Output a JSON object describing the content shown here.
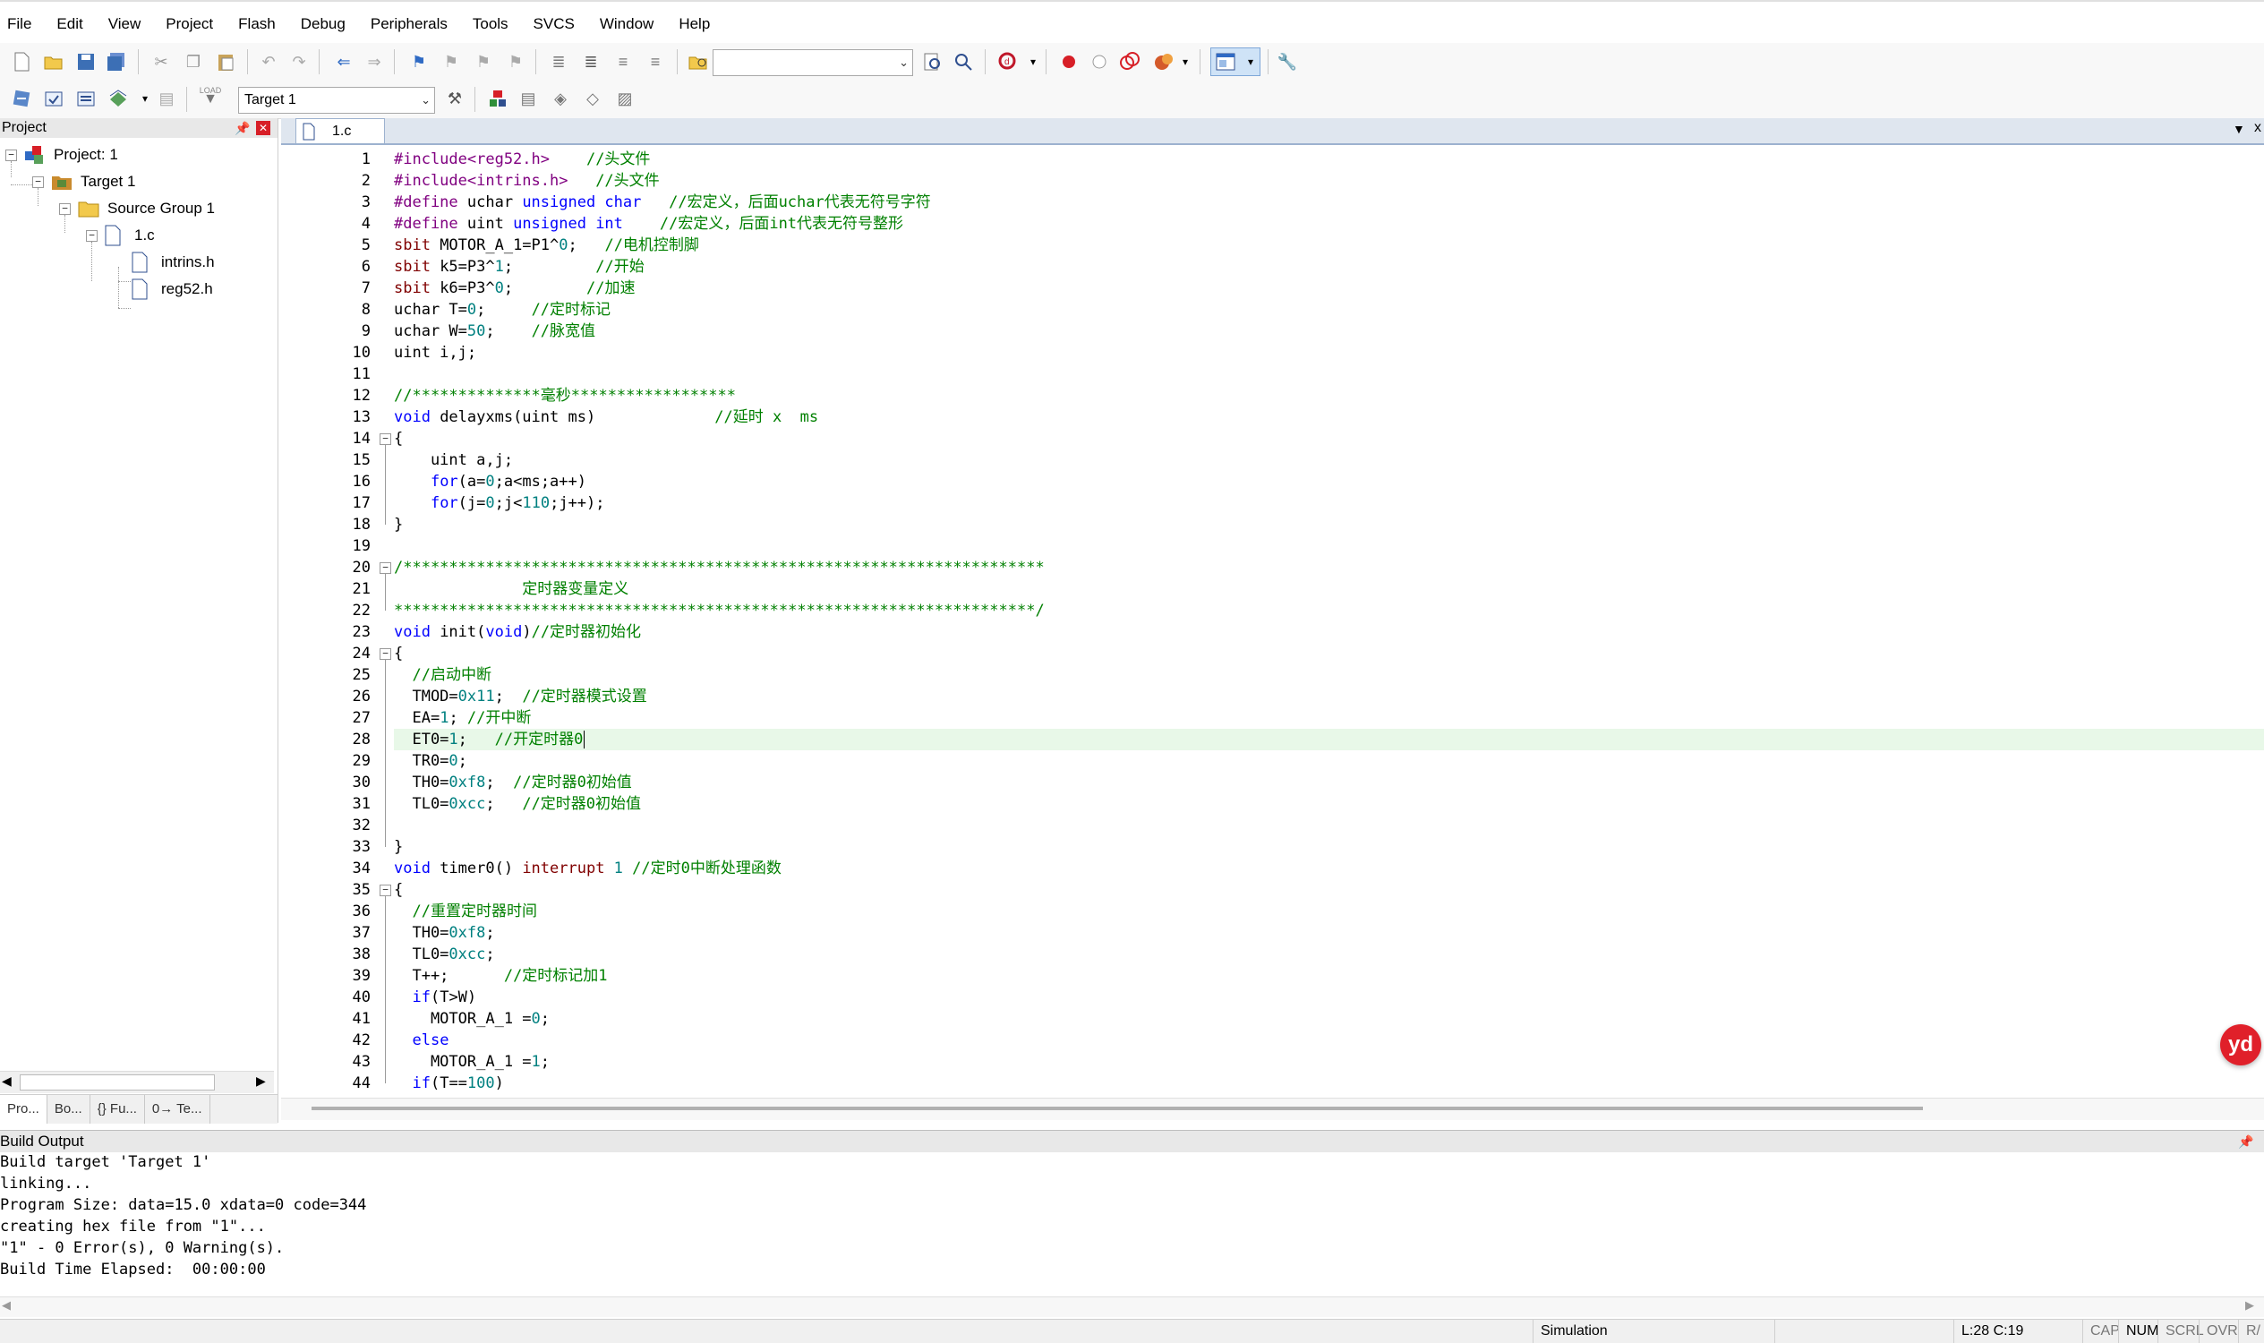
{
  "menu": [
    "File",
    "Edit",
    "View",
    "Project",
    "Flash",
    "Debug",
    "Peripherals",
    "Tools",
    "SVCS",
    "Window",
    "Help"
  ],
  "toolbar": {
    "target_select": "Target 1",
    "icons": [
      "new-file-icon",
      "open-file-icon",
      "save-icon",
      "save-all-icon",
      "cut-icon",
      "copy-icon",
      "paste-icon",
      "undo-icon",
      "redo-icon",
      "navigate-back-icon",
      "navigate-forward-icon",
      "bookmark-icon",
      "prev-bookmark-icon",
      "next-bookmark-icon",
      "clear-bookmarks-icon",
      "indent-icon",
      "unindent-icon",
      "comment-icon",
      "uncomment-icon",
      "find-in-files-icon",
      "find-icon",
      "incremental-find-icon",
      "debug-start-icon",
      "breakpoint-icon",
      "disable-breakpoint-icon",
      "kill-breakpoints-icon",
      "window-layout-icon",
      "configure-icon"
    ],
    "load_label": "LOAD"
  },
  "project": {
    "title": "Project",
    "tree": {
      "root": "Project: 1",
      "target": "Target 1",
      "group": "Source Group 1",
      "file": "1.c",
      "children": [
        "intrins.h",
        "reg52.h"
      ]
    },
    "tabs": [
      "Pro...",
      "Bo...",
      "{} Fu...",
      "0→ Te..."
    ]
  },
  "editor": {
    "tab": "1.c",
    "current_line": 28,
    "lines": [
      {
        "n": "1",
        "t": [
          [
            "pp",
            "#include<reg52.h>"
          ],
          [
            "",
            "    "
          ],
          [
            "cm",
            "//头文件"
          ]
        ]
      },
      {
        "n": "2",
        "t": [
          [
            "pp",
            "#include<intrins.h>"
          ],
          [
            "",
            "   "
          ],
          [
            "cm",
            "//头文件"
          ]
        ]
      },
      {
        "n": "3",
        "t": [
          [
            "pp",
            "#define"
          ],
          [
            "",
            " uchar "
          ],
          [
            "kw",
            "unsigned char"
          ],
          [
            "",
            "   "
          ],
          [
            "cm",
            "//宏定义，后面uchar代表无符号字符"
          ]
        ]
      },
      {
        "n": "4",
        "t": [
          [
            "pp",
            "#define"
          ],
          [
            "",
            " uint "
          ],
          [
            "kw",
            "unsigned int"
          ],
          [
            "",
            "    "
          ],
          [
            "cm",
            "//宏定义，后面int代表无符号整形"
          ]
        ]
      },
      {
        "n": "5",
        "t": [
          [
            "st",
            "sbit"
          ],
          [
            "",
            " MOTOR_A_1=P1^"
          ],
          [
            "nm",
            "0"
          ],
          [
            "",
            ";   "
          ],
          [
            "cm",
            "//电机控制脚"
          ]
        ]
      },
      {
        "n": "6",
        "t": [
          [
            "st",
            "sbit"
          ],
          [
            "",
            " k5=P3^"
          ],
          [
            "nm",
            "1"
          ],
          [
            "",
            ";         "
          ],
          [
            "cm",
            "//开始"
          ]
        ]
      },
      {
        "n": "7",
        "t": [
          [
            "st",
            "sbit"
          ],
          [
            "",
            " k6=P3^"
          ],
          [
            "nm",
            "0"
          ],
          [
            "",
            ";        "
          ],
          [
            "cm",
            "//加速"
          ]
        ]
      },
      {
        "n": "8",
        "t": [
          [
            "",
            "uchar T="
          ],
          [
            "nm",
            "0"
          ],
          [
            "",
            ";     "
          ],
          [
            "cm",
            "//定时标记"
          ]
        ]
      },
      {
        "n": "9",
        "t": [
          [
            "",
            "uchar W="
          ],
          [
            "nm",
            "50"
          ],
          [
            "",
            ";    "
          ],
          [
            "cm",
            "//脉宽值"
          ]
        ]
      },
      {
        "n": "10",
        "t": [
          [
            "",
            "uint i,j;"
          ]
        ]
      },
      {
        "n": "11",
        "t": []
      },
      {
        "n": "12",
        "t": [
          [
            "cm",
            "//**************毫秒******************"
          ]
        ]
      },
      {
        "n": "13",
        "t": [
          [
            "kw",
            "void"
          ],
          [
            "",
            " delayxms(uint ms)             "
          ],
          [
            "cm",
            "//延时 x  ms"
          ]
        ]
      },
      {
        "n": "14",
        "t": [
          [
            "",
            "{"
          ]
        ]
      },
      {
        "n": "15",
        "t": [
          [
            "",
            "    uint a,j;"
          ]
        ]
      },
      {
        "n": "16",
        "t": [
          [
            "",
            "    "
          ],
          [
            "kw",
            "for"
          ],
          [
            "",
            "(a="
          ],
          [
            "nm",
            "0"
          ],
          [
            "",
            ";a<ms;a++)"
          ]
        ]
      },
      {
        "n": "17",
        "t": [
          [
            "",
            "    "
          ],
          [
            "kw",
            "for"
          ],
          [
            "",
            "(j="
          ],
          [
            "nm",
            "0"
          ],
          [
            "",
            ";j<"
          ],
          [
            "nm",
            "110"
          ],
          [
            "",
            ";j++);"
          ]
        ]
      },
      {
        "n": "18",
        "t": [
          [
            "",
            "}"
          ]
        ]
      },
      {
        "n": "19",
        "t": []
      },
      {
        "n": "20",
        "t": [
          [
            "cm",
            "/**********************************************************************"
          ]
        ]
      },
      {
        "n": "21",
        "t": [
          [
            "cm",
            "              定时器变量定义"
          ]
        ]
      },
      {
        "n": "22",
        "t": [
          [
            "cm",
            "**********************************************************************/"
          ]
        ]
      },
      {
        "n": "23",
        "t": [
          [
            "kw",
            "void"
          ],
          [
            "",
            " init("
          ],
          [
            "kw",
            "void"
          ],
          [
            "",
            ")"
          ],
          [
            "cm",
            "//定时器初始化"
          ]
        ]
      },
      {
        "n": "24",
        "t": [
          [
            "",
            "{"
          ]
        ]
      },
      {
        "n": "25",
        "t": [
          [
            "",
            "  "
          ],
          [
            "cm",
            "//启动中断"
          ]
        ]
      },
      {
        "n": "26",
        "t": [
          [
            "",
            "  TMOD="
          ],
          [
            "nm",
            "0x11"
          ],
          [
            "",
            ";  "
          ],
          [
            "cm",
            "//定时器模式设置"
          ]
        ]
      },
      {
        "n": "27",
        "t": [
          [
            "",
            "  EA="
          ],
          [
            "nm",
            "1"
          ],
          [
            "",
            "; "
          ],
          [
            "cm",
            "//开中断"
          ]
        ]
      },
      {
        "n": "28",
        "t": [
          [
            "",
            "  ET0="
          ],
          [
            "nm",
            "1"
          ],
          [
            "",
            ";   "
          ],
          [
            "cm",
            "//开定时器0"
          ]
        ]
      },
      {
        "n": "29",
        "t": [
          [
            "",
            "  TR0="
          ],
          [
            "nm",
            "0"
          ],
          [
            "",
            ";"
          ]
        ]
      },
      {
        "n": "30",
        "t": [
          [
            "",
            "  TH0="
          ],
          [
            "nm",
            "0xf8"
          ],
          [
            "",
            ";  "
          ],
          [
            "cm",
            "//定时器0初始值"
          ]
        ]
      },
      {
        "n": "31",
        "t": [
          [
            "",
            "  TL0="
          ],
          [
            "nm",
            "0xcc"
          ],
          [
            "",
            ";   "
          ],
          [
            "cm",
            "//定时器0初始值"
          ]
        ]
      },
      {
        "n": "32",
        "t": []
      },
      {
        "n": "33",
        "t": [
          [
            "",
            "}"
          ]
        ]
      },
      {
        "n": "34",
        "t": [
          [
            "kw",
            "void"
          ],
          [
            "",
            " timer0() "
          ],
          [
            "st",
            "interrupt"
          ],
          [
            "nm",
            " 1"
          ],
          [
            "",
            " "
          ],
          [
            "cm",
            "//定时0中断处理函数"
          ]
        ]
      },
      {
        "n": "35",
        "t": [
          [
            "",
            "{"
          ]
        ]
      },
      {
        "n": "36",
        "t": [
          [
            "",
            "  "
          ],
          [
            "cm",
            "//重置定时器时间"
          ]
        ]
      },
      {
        "n": "37",
        "t": [
          [
            "",
            "  TH0="
          ],
          [
            "nm",
            "0xf8"
          ],
          [
            "",
            ";"
          ]
        ]
      },
      {
        "n": "38",
        "t": [
          [
            "",
            "  TL0="
          ],
          [
            "nm",
            "0xcc"
          ],
          [
            "",
            ";"
          ]
        ]
      },
      {
        "n": "39",
        "t": [
          [
            "",
            "  T++;      "
          ],
          [
            "cm",
            "//定时标记加1"
          ]
        ]
      },
      {
        "n": "40",
        "t": [
          [
            "",
            "  "
          ],
          [
            "kw",
            "if"
          ],
          [
            "",
            "(T>W)"
          ]
        ]
      },
      {
        "n": "41",
        "t": [
          [
            "",
            "    MOTOR_A_1 ="
          ],
          [
            "nm",
            "0"
          ],
          [
            "",
            ";"
          ]
        ]
      },
      {
        "n": "42",
        "t": [
          [
            "",
            "  "
          ],
          [
            "kw",
            "else"
          ]
        ]
      },
      {
        "n": "43",
        "t": [
          [
            "",
            "    MOTOR_A_1 ="
          ],
          [
            "nm",
            "1"
          ],
          [
            "",
            ";"
          ]
        ]
      },
      {
        "n": "44",
        "t": [
          [
            "",
            "  "
          ],
          [
            "kw",
            "if"
          ],
          [
            "",
            "(T=="
          ],
          [
            "nm",
            "100"
          ],
          [
            "",
            ")"
          ]
        ]
      }
    ]
  },
  "build": {
    "title": "Build Output",
    "lines": [
      "Build target 'Target 1'",
      "linking...",
      "Program Size: data=15.0 xdata=0 code=344",
      "creating hex file from \"1\"...",
      "\"1\" - 0 Error(s), 0 Warning(s).",
      "Build Time Elapsed:  00:00:00"
    ]
  },
  "status": {
    "mode": "Simulation",
    "position": "L:28 C:19",
    "caps": "CAP",
    "num": "NUM",
    "scrl": "SCRL",
    "ovr": "OVR",
    "rw": "R/"
  },
  "colors": {
    "comment": "#008000",
    "keyword": "#0000ff",
    "number": "#008080",
    "preproc": "#800080",
    "sfr": "#800000",
    "current_line": "#e8f8e8"
  }
}
